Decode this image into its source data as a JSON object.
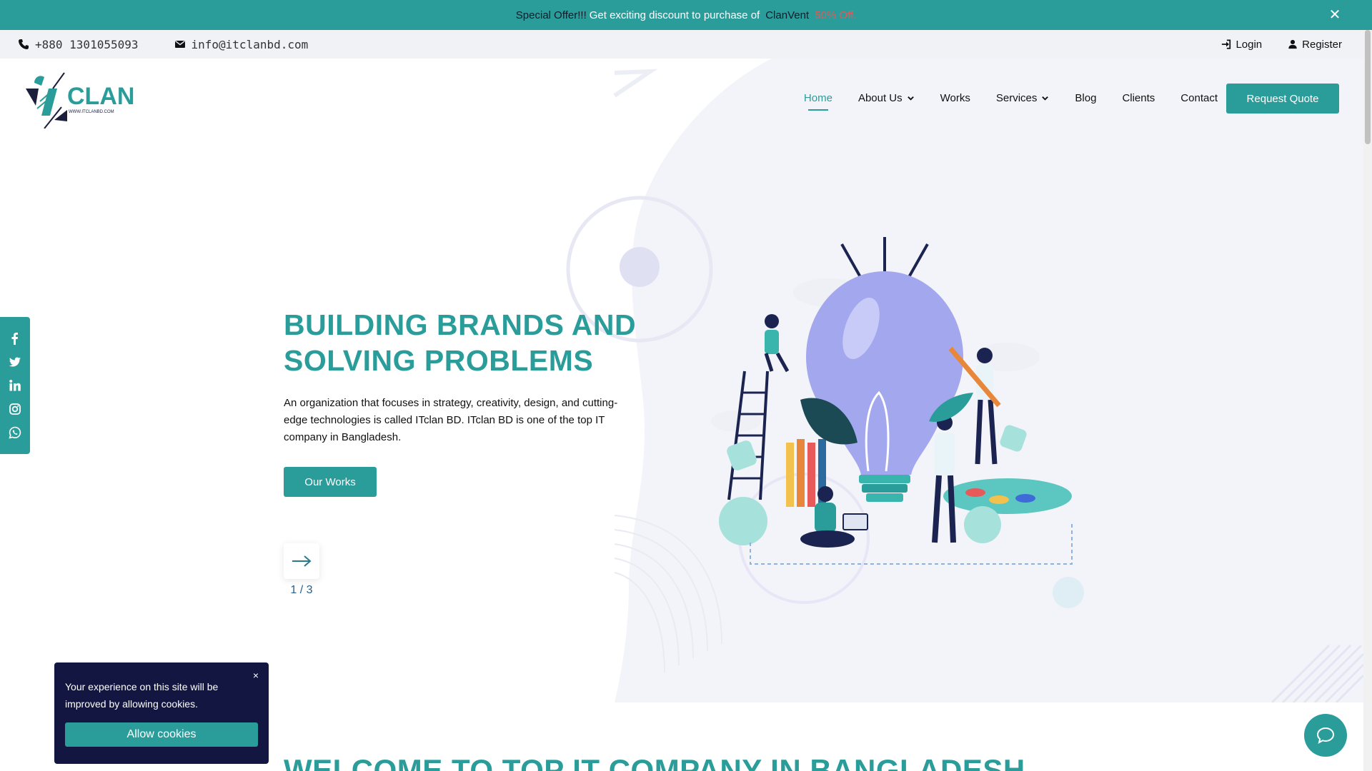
{
  "offer": {
    "lead": "Special Offer!!!",
    "message": "Get exciting discount to purchase of",
    "product": "ClanVent",
    "discount": "50% Off.",
    "close_icon": "close-icon"
  },
  "contact": {
    "phone": "+880 1301055093",
    "email": "info@itclanbd.com",
    "login": "Login",
    "register": "Register"
  },
  "nav": {
    "items": [
      {
        "label": "Home",
        "active": true
      },
      {
        "label": "About Us",
        "dropdown": true
      },
      {
        "label": "Works"
      },
      {
        "label": "Services",
        "dropdown": true
      },
      {
        "label": "Blog"
      },
      {
        "label": "Clients"
      },
      {
        "label": "Contact"
      }
    ],
    "quote_button": "Request Quote"
  },
  "logo": {
    "text": "CLAN",
    "url_text": "WWW.ITCLANBD.COM"
  },
  "social": [
    "facebook-icon",
    "twitter-icon",
    "linkedin-icon",
    "instagram-icon",
    "whatsapp-icon"
  ],
  "hero": {
    "title_line1": "BUILDING BRANDS AND",
    "title_line2": "SOLVING PROBLEMS",
    "description": "An organization that focuses in strategy, creativity, design, and cutting-edge technologies is called ITclan BD. ITclan BD is one of the top IT company in Bangladesh.",
    "button": "Our Works",
    "pager": "1 / 3"
  },
  "welcome": {
    "heading": "WELCOME TO TOP IT COMPANY IN BANGLADESH"
  },
  "cookie": {
    "text": "Your experience on this site will be improved by allowing cookies.",
    "button": "Allow cookies",
    "close": "×"
  },
  "colors": {
    "accent": "#2a9d9b",
    "dark": "#121640",
    "offer_discount": "#e05a5a"
  }
}
